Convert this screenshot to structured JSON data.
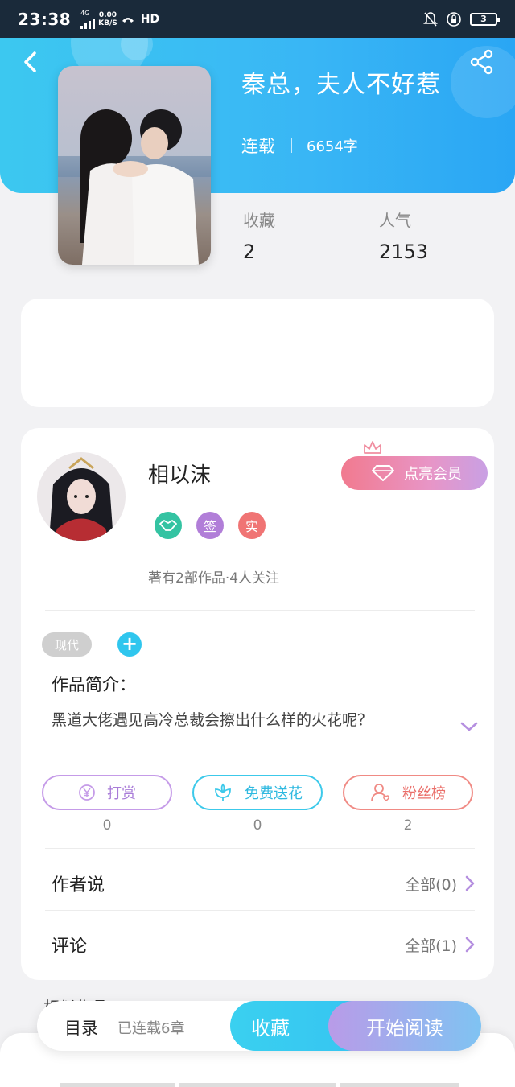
{
  "status_bar": {
    "time": "23:38",
    "network": "4G",
    "speed_value": "0.00",
    "speed_unit": "KB/S",
    "hd": "HD",
    "battery": "3"
  },
  "book": {
    "title": "秦总，夫人不好惹",
    "status": "连载",
    "word_count": "6654字",
    "stats": [
      {
        "label": "收藏",
        "value": "2"
      },
      {
        "label": "人气",
        "value": "2153"
      }
    ]
  },
  "author": {
    "name": "相以沫",
    "vip_button": "点亮会员",
    "badges": [
      {
        "icon": "handshake-icon",
        "text": "",
        "color": "#34c3a2"
      },
      {
        "icon": "signed-badge",
        "text": "签",
        "color": "#b17ed8"
      },
      {
        "icon": "verified-badge",
        "text": "实",
        "color": "#f07474"
      }
    ],
    "meta": "著有2部作品·4人关注"
  },
  "tags": [
    "现代"
  ],
  "add_tag_symbol": "+",
  "intro": {
    "title": "作品简介：",
    "text": "黑道大佬遇见高冷总裁会擦出什么样的火花呢？"
  },
  "actions": [
    {
      "icon": "yen-coin-icon",
      "label": "打赏",
      "count": "0",
      "color": "#c59be8"
    },
    {
      "icon": "flower-icon",
      "label": "免费送花",
      "count": "0",
      "color": "#3cc9ea"
    },
    {
      "icon": "fan-user-icon",
      "label": "粉丝榜",
      "count": "2",
      "color": "#f08a84"
    }
  ],
  "sections": [
    {
      "title": "作者说",
      "more": "全部(0)"
    },
    {
      "title": "评论",
      "more": "全部(1)"
    }
  ],
  "peek_text": "相似作品",
  "bottom_bar": {
    "toc": "目录",
    "chapters": "已连载6章",
    "collect": "收藏",
    "read": "开始阅读"
  },
  "colors": {
    "header_gradient_start": "#3cc8f0",
    "header_gradient_end": "#2aa6f4",
    "accent_cyan": "#2fc6ee",
    "accent_purple": "#b99be8",
    "vip_pink": "#f17a8f"
  }
}
